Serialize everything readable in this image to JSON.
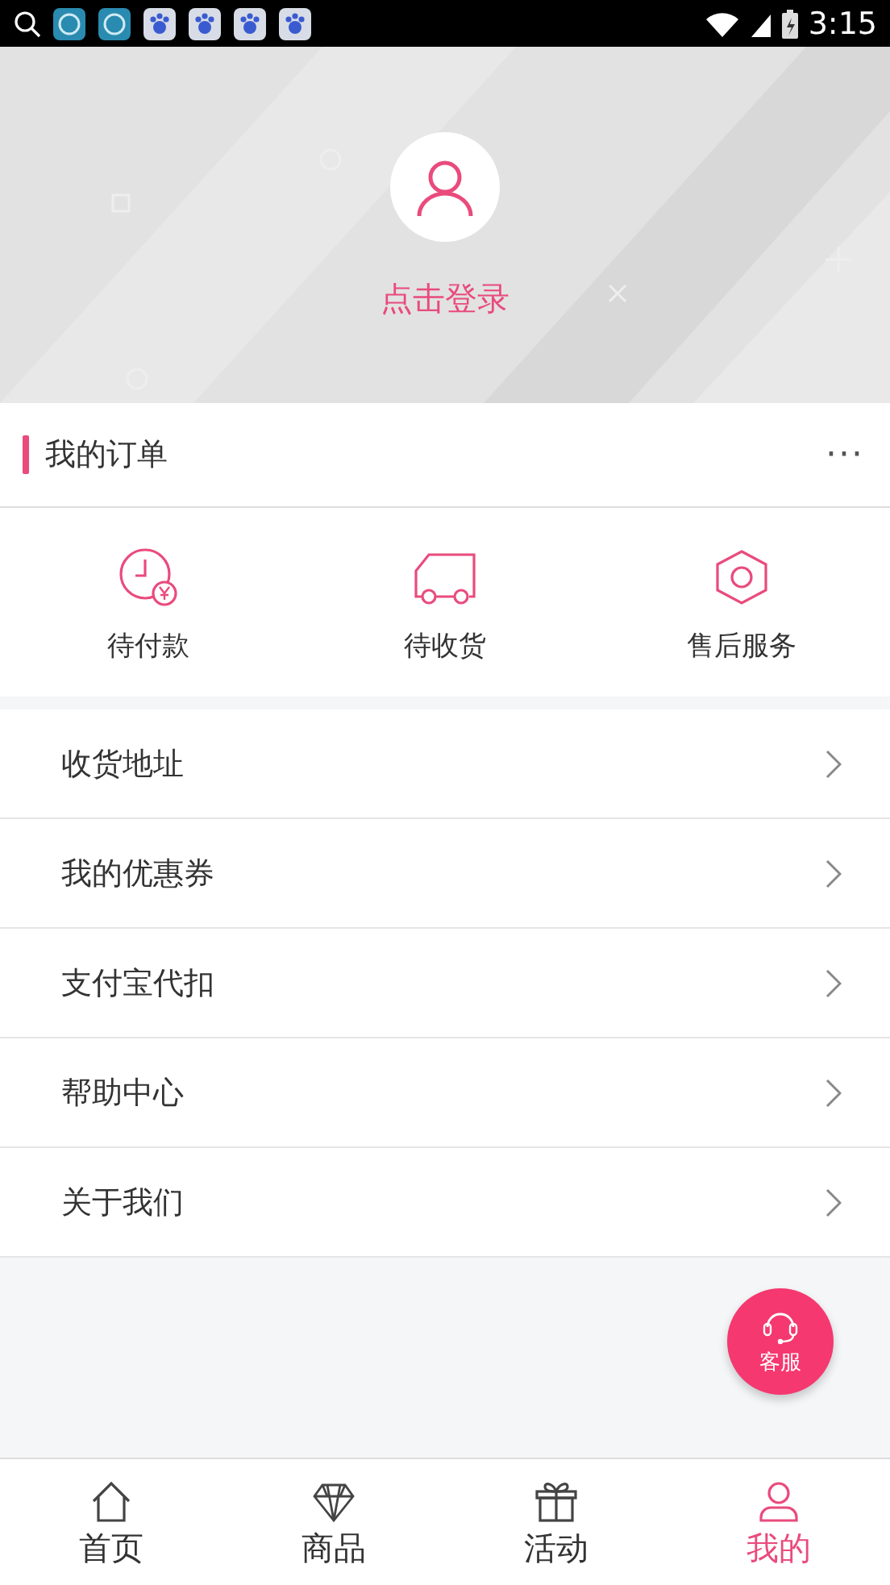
{
  "status_bar": {
    "time": "3:15",
    "notifications": [
      {
        "kind": "circle"
      },
      {
        "kind": "circle"
      },
      {
        "kind": "paw"
      },
      {
        "kind": "paw"
      },
      {
        "kind": "paw"
      },
      {
        "kind": "paw"
      }
    ]
  },
  "profile": {
    "login_label": "点击登录"
  },
  "orders": {
    "title": "我的订单",
    "more": "···",
    "items": [
      {
        "kind": "clock",
        "label": "待付款"
      },
      {
        "kind": "truck",
        "label": "待收货"
      },
      {
        "kind": "hexagon",
        "label": "售后服务"
      }
    ]
  },
  "menu": [
    {
      "label": "收货地址"
    },
    {
      "label": "我的优惠券"
    },
    {
      "label": "支付宝代扣"
    },
    {
      "label": "帮助中心"
    },
    {
      "label": "关于我们"
    }
  ],
  "service_button": {
    "label": "客服"
  },
  "tab_bar": [
    {
      "kind": "home",
      "label": "首页",
      "selected": false
    },
    {
      "kind": "diamond",
      "label": "商品",
      "selected": false
    },
    {
      "kind": "gift",
      "label": "活动",
      "selected": false
    },
    {
      "kind": "user",
      "label": "我的",
      "selected": true
    }
  ]
}
